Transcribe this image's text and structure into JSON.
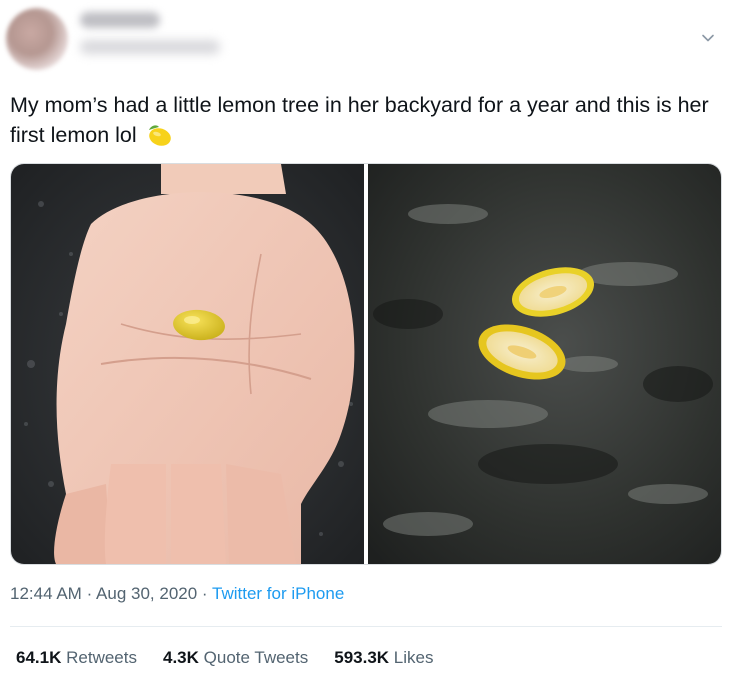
{
  "tweet": {
    "text": "My mom’s had a little lemon tree in her backyard for a year and this is her first lemon lol",
    "emoji_icon": "lemon-icon",
    "time": "12:44 AM",
    "separator": "·",
    "date": "Aug 30, 2020",
    "source": "Twitter for iPhone"
  },
  "stats": {
    "retweets_count": "64.1K",
    "retweets_label": "Retweets",
    "quotes_count": "4.3K",
    "quotes_label": "Quote Tweets",
    "likes_count": "593.3K",
    "likes_label": "Likes"
  },
  "colors": {
    "text": "#0f1419",
    "secondary": "#536471",
    "link": "#1d9bf0"
  }
}
